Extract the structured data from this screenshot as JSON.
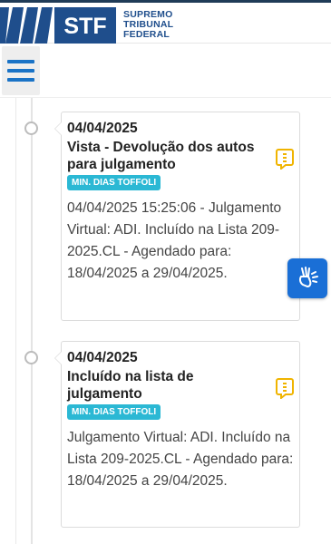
{
  "header": {
    "logo_abbrev": "STF",
    "logo_lines": [
      "SUPREMO",
      "TRIBUNAL",
      "FEDERAL"
    ]
  },
  "colors": {
    "brand_blue": "#1f4e8c",
    "menu_blue": "#1a73c6",
    "badge_cyan": "#2bb8d4",
    "note_yellow": "#f0b400",
    "access_blue": "#1a6fd6"
  },
  "icons": {
    "menu": "hamburger-icon",
    "note": "note-icon",
    "accessibility": "sign-language-hands-icon"
  },
  "timeline": {
    "items": [
      {
        "date": "04/04/2025",
        "title": "Vista - Devolução dos autos para julgamento",
        "badge": "MIN. DIAS TOFFOLI",
        "description": "04/04/2025 15:25:06 - Julgamento Virtual: ADI. Incluído na Lista 209-2025.CL - Agendado para: 18/04/2025 a 29/04/2025."
      },
      {
        "date": "04/04/2025",
        "title": "Incluído na lista de julgamento",
        "badge": "MIN. DIAS TOFFOLI",
        "description": "Julgamento Virtual: ADI. Incluído na Lista 209-2025.CL - Agendado para: 18/04/2025 a 29/04/2025."
      }
    ]
  }
}
